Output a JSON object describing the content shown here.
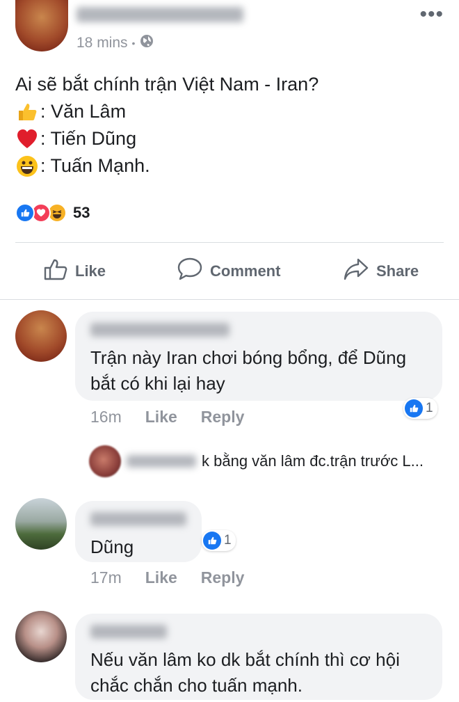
{
  "post": {
    "time": "18 mins",
    "separator": "•",
    "text_question": "Ai sẽ bắt chính trận Việt Nam - Iran?",
    "options": [
      {
        "icon": "thumbs-up",
        "label": ": Văn Lâm"
      },
      {
        "icon": "heart",
        "label": ": Tiến Dũng"
      },
      {
        "icon": "grinning-face",
        "label": ": Tuấn Mạnh."
      }
    ],
    "reaction_count": "53"
  },
  "actions": {
    "like": "Like",
    "comment": "Comment",
    "share": "Share"
  },
  "comments": [
    {
      "text": "Trận này Iran chơi bóng bổng, để Dũng bắt có khi lại hay",
      "time": "16m",
      "like": "Like",
      "reply": "Reply",
      "like_count": "1"
    },
    {
      "text": "Dũng",
      "time": "17m",
      "like": "Like",
      "reply": "Reply",
      "like_count": "1"
    },
    {
      "text": "Nếu văn lâm ko dk bắt chính thì cơ hội chắc chắn cho tuấn mạnh."
    }
  ],
  "reply_preview": {
    "text": "k bằng văn lâm đc.trận trước L..."
  },
  "colors": {
    "facebook_blue": "#1877f2",
    "love_red": "#f33e58",
    "haha_yellow": "#f7b125",
    "muted_text": "#90949c",
    "bubble_bg": "#f2f3f5"
  }
}
